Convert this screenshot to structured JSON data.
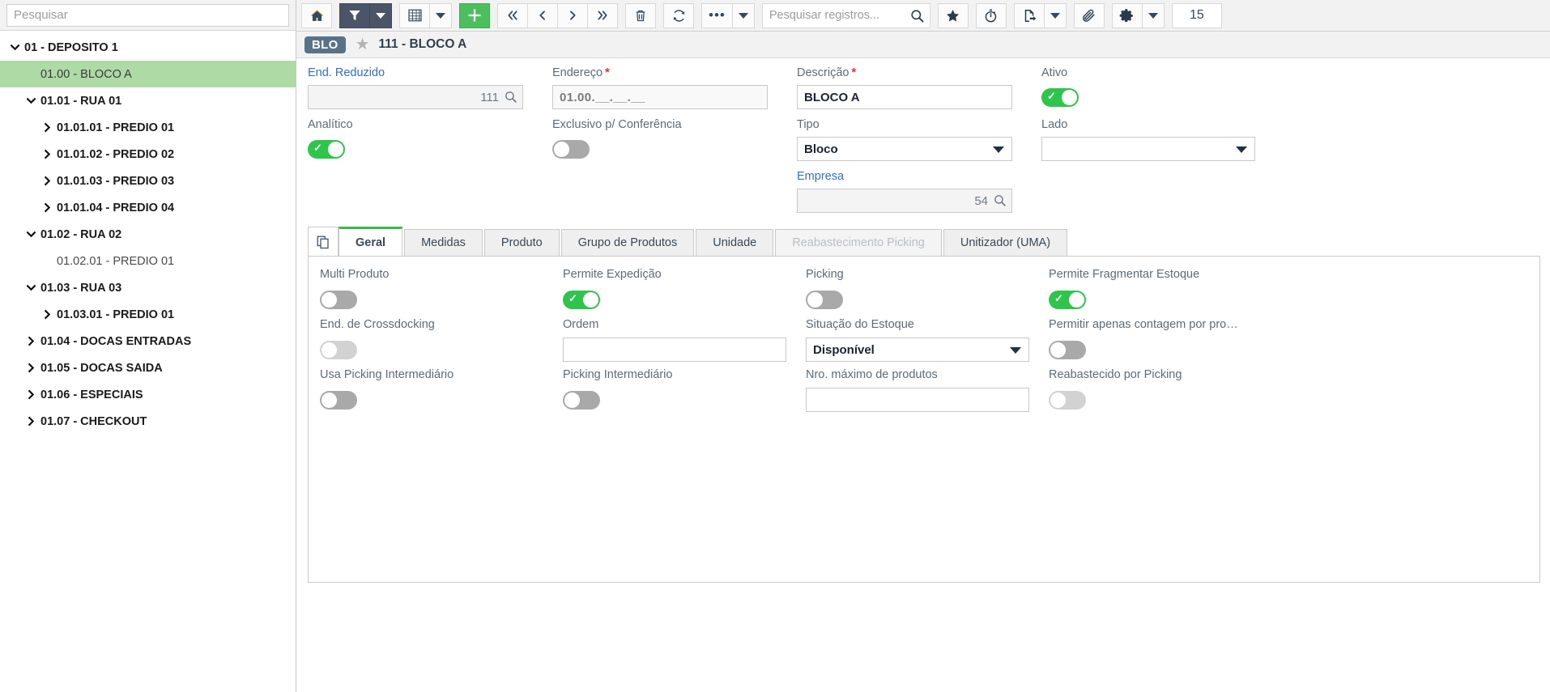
{
  "sidebar": {
    "search_placeholder": "Pesquisar",
    "tree": [
      {
        "label": "01 - DEPOSITO 1",
        "depth": 0,
        "state": "expanded",
        "selected": false
      },
      {
        "label": "01.00 - BLOCO A",
        "depth": 1,
        "state": "leaf",
        "selected": true
      },
      {
        "label": "01.01 - RUA 01",
        "depth": 1,
        "state": "expanded",
        "selected": false
      },
      {
        "label": "01.01.01 - PREDIO 01",
        "depth": 2,
        "state": "collapsed",
        "selected": false
      },
      {
        "label": "01.01.02 - PREDIO 02",
        "depth": 2,
        "state": "collapsed",
        "selected": false
      },
      {
        "label": "01.01.03 - PREDIO 03",
        "depth": 2,
        "state": "collapsed",
        "selected": false
      },
      {
        "label": "01.01.04 - PREDIO 04",
        "depth": 2,
        "state": "collapsed",
        "selected": false
      },
      {
        "label": "01.02 - RUA 02",
        "depth": 1,
        "state": "expanded",
        "selected": false
      },
      {
        "label": "01.02.01 - PREDIO 01",
        "depth": 2,
        "state": "leaf",
        "selected": false
      },
      {
        "label": "01.03 - RUA 03",
        "depth": 1,
        "state": "expanded",
        "selected": false
      },
      {
        "label": "01.03.01 - PREDIO 01",
        "depth": 2,
        "state": "collapsed",
        "selected": false
      },
      {
        "label": "01.04 - DOCAS ENTRADAS",
        "depth": 1,
        "state": "collapsed",
        "selected": false
      },
      {
        "label": "01.05 - DOCAS SAIDA",
        "depth": 1,
        "state": "collapsed",
        "selected": false
      },
      {
        "label": "01.06 - ESPECIAIS",
        "depth": 1,
        "state": "collapsed",
        "selected": false
      },
      {
        "label": "01.07 - CHECKOUT",
        "depth": 1,
        "state": "collapsed",
        "selected": false
      }
    ]
  },
  "toolbar": {
    "home_icon": "home-icon",
    "filter_icon": "filter-icon",
    "filter_active": true,
    "grid_icon": "grid-icon",
    "add_icon": "plus-icon",
    "first_icon": "first-page-icon",
    "prev_icon": "previous-page-icon",
    "next_icon": "next-page-icon",
    "last_icon": "last-page-icon",
    "delete_icon": "trash-icon",
    "refresh_icon": "refresh-icon",
    "more_icon": "ellipsis-icon",
    "search_placeholder": "Pesquisar registros...",
    "search_value": "",
    "search_icon": "magnifier-icon",
    "favorite_icon": "star-icon",
    "timer_icon": "stopwatch-icon",
    "export_icon": "export-document-icon",
    "attachment_icon": "paperclip-icon",
    "settings_icon": "gear-icon",
    "page_size": "15",
    "accent_green": "#4bbf5d",
    "accent_dark": "#4a5568"
  },
  "record_header": {
    "badge": "BLO",
    "favorite_icon": "star-icon",
    "title": "111 - BLOCO A"
  },
  "form": {
    "end_reduzido": {
      "label": "End. Reduzido",
      "value": "111",
      "lookup_icon": "magnifier-icon"
    },
    "endereco": {
      "label": "Endereço",
      "required": true,
      "value": "01.00.__.__.__"
    },
    "descricao": {
      "label": "Descrição",
      "required": true,
      "value": "BLOCO A"
    },
    "ativo": {
      "label": "Ativo",
      "value": true
    },
    "analitico": {
      "label": "Analítico",
      "value": true
    },
    "exclusivo_conferencia": {
      "label": "Exclusivo p/ Conferência",
      "value": false
    },
    "tipo": {
      "label": "Tipo",
      "value": "Bloco",
      "options": [
        "Bloco"
      ]
    },
    "lado": {
      "label": "Lado",
      "value": "",
      "options": []
    },
    "empresa": {
      "label": "Empresa",
      "value": "54",
      "lookup_icon": "magnifier-icon"
    }
  },
  "tabs": {
    "copy_icon": "copy-icon",
    "items": [
      {
        "label": "Geral",
        "active": true,
        "disabled": false
      },
      {
        "label": "Medidas",
        "active": false,
        "disabled": false
      },
      {
        "label": "Produto",
        "active": false,
        "disabled": false
      },
      {
        "label": "Grupo de Produtos",
        "active": false,
        "disabled": false
      },
      {
        "label": "Unidade",
        "active": false,
        "disabled": false
      },
      {
        "label": "Reabastecimento Picking",
        "active": false,
        "disabled": true
      },
      {
        "label": "Unitizador (UMA)",
        "active": false,
        "disabled": false
      }
    ]
  },
  "geral": {
    "multi_produto": {
      "label": "Multi Produto",
      "value": false,
      "disabled": false
    },
    "permite_expedicao": {
      "label": "Permite Expedição",
      "value": true,
      "disabled": false
    },
    "picking": {
      "label": "Picking",
      "value": false,
      "disabled": false
    },
    "permite_fragmentar": {
      "label": "Permite Fragmentar Estoque",
      "value": true,
      "disabled": false
    },
    "end_crossdocking": {
      "label": "End. de Crossdocking",
      "value": false,
      "disabled": true
    },
    "ordem": {
      "label": "Ordem",
      "value": ""
    },
    "situacao_estoque": {
      "label": "Situação do Estoque",
      "value": "Disponível",
      "options": [
        "Disponível"
      ]
    },
    "permitir_contagem": {
      "label": "Permitir apenas contagem por pro…",
      "value": false,
      "disabled": false
    },
    "usa_picking_interm": {
      "label": "Usa Picking Intermediário",
      "value": false,
      "disabled": false
    },
    "picking_intermediario": {
      "label": "Picking Intermediário",
      "value": false,
      "disabled": false
    },
    "nro_max_produtos": {
      "label": "Nro. máximo de produtos",
      "value": ""
    },
    "reabastecido_picking": {
      "label": "Reabastecido por Picking",
      "value": false,
      "disabled": true
    }
  }
}
